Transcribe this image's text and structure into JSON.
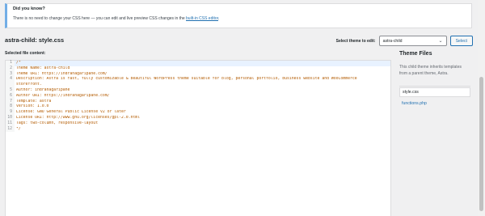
{
  "notice": {
    "title": "Did you know?",
    "text_before": "There is no need to change your CSS here — you can edit and live preview CSS changes in the ",
    "link": "built-in CSS editor",
    "text_after": "."
  },
  "editor_header": {
    "file_title": "astra-child: style.css",
    "select_label": "Select theme to edit:",
    "selected_theme": "astra-child",
    "select_button": "Select"
  },
  "selected_file_label": "Selected file content:",
  "code_lines": [
    {
      "n": "1",
      "text": "/*"
    },
    {
      "n": "2",
      "text": "Theme Name: astra-child"
    },
    {
      "n": "3",
      "text": "Theme URI: https://indranagaripane.com/"
    },
    {
      "n": "4",
      "text": "Description: Astra is fast, fully customizable & beautiful WordPress theme suitable for blog, personal portfolio, business website and WooCommerce"
    },
    {
      "n": "",
      "text": "storefront."
    },
    {
      "n": "5",
      "text": "Author: indranagaripane"
    },
    {
      "n": "6",
      "text": "Author URI: https://indranagaripane.com/"
    },
    {
      "n": "7",
      "text": "Template: astra"
    },
    {
      "n": "8",
      "text": "Version: 1.0.0"
    },
    {
      "n": "9",
      "text": "License: GNU General Public License v2 or later"
    },
    {
      "n": "10",
      "text": "License URI: http://www.gnu.org/licenses/gpl-2.0.html"
    },
    {
      "n": "11",
      "text": "Tags: two-column, responsive-layout"
    },
    {
      "n": "12",
      "text": "*/"
    }
  ],
  "theme_files": {
    "heading": "Theme Files",
    "description": "This child theme inherits templates from a parent theme, Astra.",
    "files": [
      "style.css",
      "functions.php"
    ]
  },
  "colors": {
    "accent": "#2271b1",
    "notice_border": "#72aee6",
    "code_text": "#b35b00"
  }
}
